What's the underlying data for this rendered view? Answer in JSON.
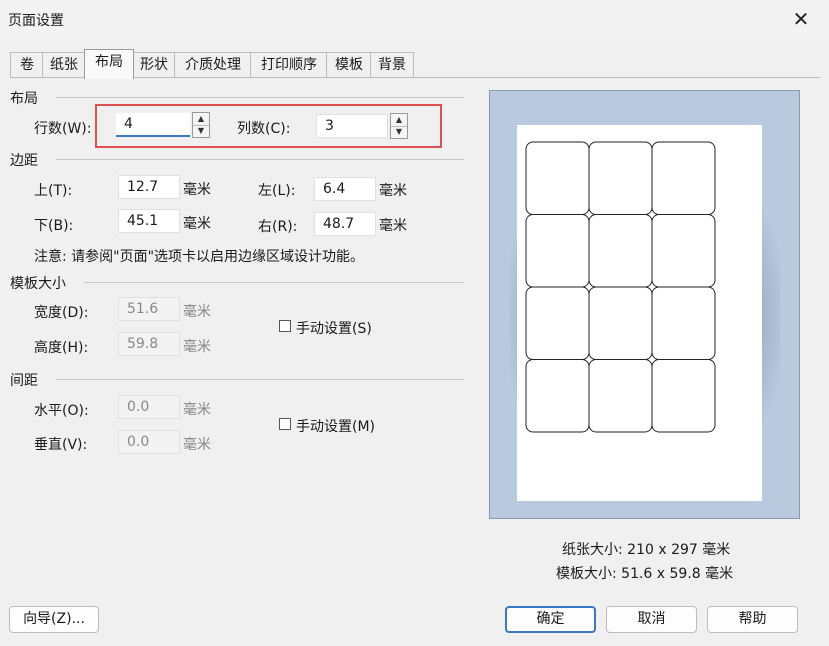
{
  "window": {
    "title": "页面设置",
    "close": "✕"
  },
  "tabs": [
    {
      "label": "卷"
    },
    {
      "label": "纸张"
    },
    {
      "label": "布局"
    },
    {
      "label": "形状"
    },
    {
      "label": "介质处理"
    },
    {
      "label": "打印顺序"
    },
    {
      "label": "模板"
    },
    {
      "label": "背景"
    }
  ],
  "layout": {
    "heading": "布局",
    "rows_label": "行数(W):",
    "rows_value": "4",
    "cols_label": "列数(C):",
    "cols_value": "3"
  },
  "margins": {
    "heading": "边距",
    "top_label": "上(T):",
    "top_value": "12.7",
    "left_label": "左(L):",
    "left_value": "6.4",
    "bottom_label": "下(B):",
    "bottom_value": "45.1",
    "right_label": "右(R):",
    "right_value": "48.7",
    "unit": "毫米",
    "note": "注意: 请参阅\"页面\"选项卡以启用边缘区域设计功能。"
  },
  "template_size": {
    "heading": "模板大小",
    "width_label": "宽度(D):",
    "width_value": "51.6",
    "height_label": "高度(H):",
    "height_value": "59.8",
    "unit": "毫米",
    "manual_label": "手动设置(S)",
    "manual_checked": false
  },
  "spacing": {
    "heading": "间距",
    "horizontal_label": "水平(O):",
    "horizontal_value": "0.0",
    "vertical_label": "垂直(V):",
    "vertical_value": "0.0",
    "unit": "毫米",
    "manual_label": "手动设置(M)",
    "manual_checked": false
  },
  "preview": {
    "rows": 4,
    "cols": 3,
    "paper_size": "纸张大小: 210 x 297 毫米",
    "template_size": "模板大小: 51.6 x 59.8 毫米"
  },
  "buttons": {
    "wizard": "向导(Z)...",
    "ok": "确定",
    "cancel": "取消",
    "help": "帮助"
  },
  "colors": {
    "highlight_box": "#e05050",
    "preview_bg": "#b9c9de",
    "primary_border": "#3a78c8"
  }
}
